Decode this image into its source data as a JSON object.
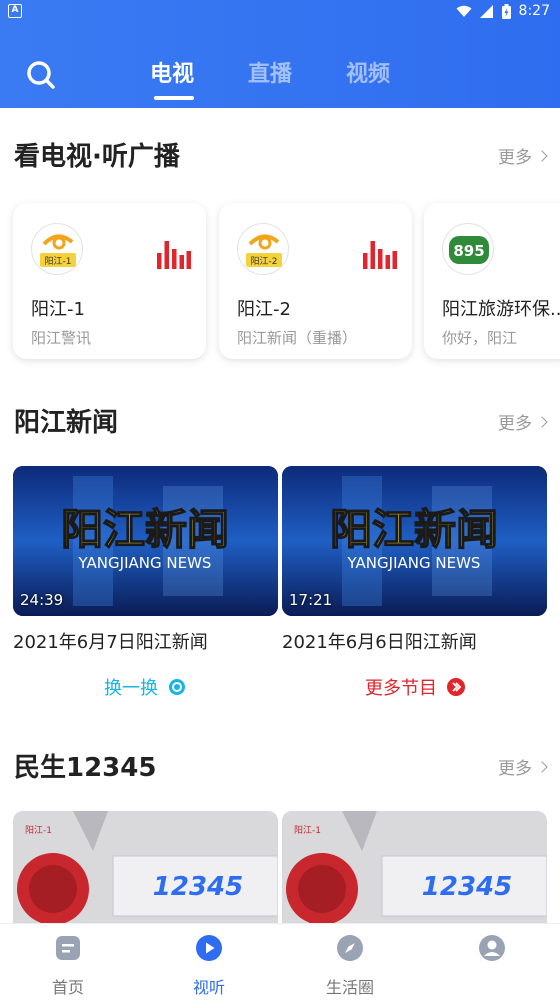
{
  "status_bar": {
    "app_badge": "A",
    "time": "8:27"
  },
  "header": {
    "tabs": [
      {
        "label": "电视",
        "active": true
      },
      {
        "label": "直播",
        "active": false
      },
      {
        "label": "视频",
        "active": false
      }
    ]
  },
  "section_radio": {
    "title": "看电视·听广播",
    "more": "更多",
    "channels": [
      {
        "name": "阳江-1",
        "subtitle": "阳江警讯",
        "logo_text": "阳江-1"
      },
      {
        "name": "阳江-2",
        "subtitle": "阳江新闻（重播）",
        "logo_text": "阳江-2"
      },
      {
        "name": "阳江旅游环保...",
        "subtitle": "你好，阳江",
        "logo_text": "895"
      }
    ]
  },
  "section_news": {
    "title": "阳江新闻",
    "more": "更多",
    "thumb_title": "阳江新闻",
    "thumb_subtitle": "YANGJIANG NEWS",
    "items": [
      {
        "duration": "24:39",
        "caption": "2021年6月7日阳江新闻"
      },
      {
        "duration": "17:21",
        "caption": "2021年6月6日阳江新闻"
      }
    ],
    "refresh_label": "换一换",
    "more_programs_label": "更多节目"
  },
  "section_minsheng": {
    "title": "民生12345",
    "more": "更多",
    "thumb_text": "12345",
    "thumb_logo": "阳江-1"
  },
  "bottom_nav": [
    {
      "label": "首页",
      "active": false
    },
    {
      "label": "视听",
      "active": true
    },
    {
      "label": "生活圈",
      "active": false
    }
  ],
  "colors": {
    "brand_blue": "#2f6df0",
    "accent_red": "#e0262c",
    "refresh_cyan": "#17b4e6"
  }
}
